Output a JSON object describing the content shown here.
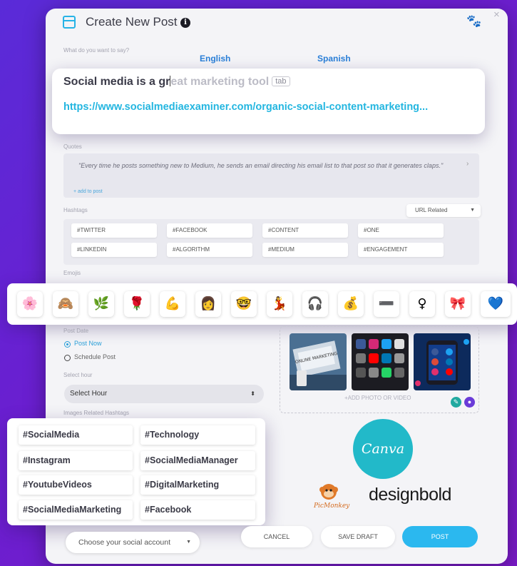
{
  "dialog": {
    "title": "Create New Post",
    "close_glyph": "×",
    "prompt_label": "What do you want to say?",
    "lang_english": "English",
    "lang_spanish": "Spanish"
  },
  "composer": {
    "typed_text": "Social media is a gr",
    "suggestion_text": "eat marketing tool",
    "tab_hint": "tab",
    "link": "https://www.socialmediaexaminer.com/organic-social-content-marketing..."
  },
  "quotes": {
    "label": "Quotes",
    "text": "\"Every time he posts something new to Medium, he sends an email directing his email list to that post so that it generates claps.\"",
    "add_link": "+ add to post"
  },
  "hashtags": {
    "label": "Hashtags",
    "filter_value": "URL Related",
    "items": [
      "#TWITTER",
      "#FACEBOOK",
      "#CONTENT",
      "#ONE",
      "#LINKEDIN",
      "#ALGORITHM",
      "#MEDIUM",
      "#ENGAGEMENT"
    ]
  },
  "emojis": {
    "label": "Emojis",
    "items": [
      "🌸",
      "🙈",
      "🌿",
      "🌹",
      "💪",
      "👩",
      "🤓",
      "💃",
      "🎧",
      "💰",
      "➖",
      "♀",
      "🎀",
      "💙"
    ]
  },
  "post_date": {
    "label": "Post Date",
    "option_now": "Post Now",
    "option_schedule": "Schedule Post",
    "hour_label": "Select hour",
    "hour_value": "Select Hour",
    "selected": "Post Now"
  },
  "media": {
    "add_label": "+ADD PHOTO OR VIDEO",
    "thumb1_text": "ONLINE MARKETING"
  },
  "image_hashtags": {
    "label": "Images Related Hashtags",
    "items": [
      "#SocialMedia",
      "#Technology",
      "#Instagram",
      "#SocialMediaManager",
      "#YoutubeVideos",
      "#DigitalMarketing",
      "#SocialMediaMarketing",
      "#Facebook"
    ]
  },
  "integrations": {
    "canva": "Canva",
    "picmonkey": "PicMonkey",
    "designbold": "designbold"
  },
  "footer": {
    "account_placeholder": "Choose your social account",
    "cancel": "CANCEL",
    "save_draft": "SAVE DRAFT",
    "post": "POST"
  },
  "colors": {
    "accent_blue": "#27b3e6",
    "post_button": "#2bb8ef",
    "canva_teal": "#22b9c9",
    "background_purple": "#6a1fd0"
  }
}
